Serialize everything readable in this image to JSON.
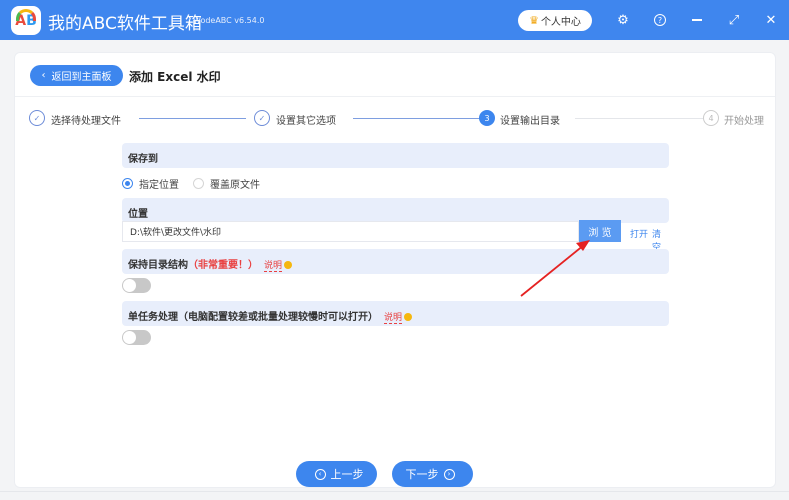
{
  "app": {
    "title": "我的ABC软件工具箱",
    "version": "WodeABC v6.54.0",
    "logo_a": "A",
    "logo_b": "B",
    "user_center": "个人中心",
    "icons": [
      "crown-icon",
      "gear-icon",
      "help-icon",
      "minimize-icon",
      "maximize-icon",
      "close-icon"
    ]
  },
  "header": {
    "back_label": "返回到主面板",
    "page_title": "添加 Excel 水印"
  },
  "steps": [
    {
      "index": "1",
      "label": "选择待处理文件",
      "state": "done"
    },
    {
      "index": "2",
      "label": "设置其它选项",
      "state": "done"
    },
    {
      "index": "3",
      "label": "设置输出目录",
      "state": "current"
    },
    {
      "index": "4",
      "label": "开始处理",
      "state": "todo"
    }
  ],
  "save_to": {
    "heading": "保存到",
    "options": [
      {
        "label": "指定位置",
        "checked": true
      },
      {
        "label": "覆盖原文件",
        "checked": false
      }
    ]
  },
  "location": {
    "heading": "位置",
    "value": "D:\\软件\\更改文件\\水印",
    "browse": "浏 览",
    "open": "打开",
    "clear": "清空"
  },
  "keep_structure": {
    "heading": "保持目录结构",
    "warning": "（非常重要！）",
    "explain": "说明",
    "enabled": false
  },
  "single_task": {
    "heading": "单任务处理（电脑配置较差或批量处理较慢时可以打开）",
    "explain": "说明",
    "enabled": false
  },
  "footer": {
    "prev": "上一步",
    "next": "下一步"
  },
  "colors": {
    "brand": "#3f86ee",
    "section_bg": "#e8eefb",
    "warning": "#e94040",
    "annotation_arrow": "#e52222"
  }
}
